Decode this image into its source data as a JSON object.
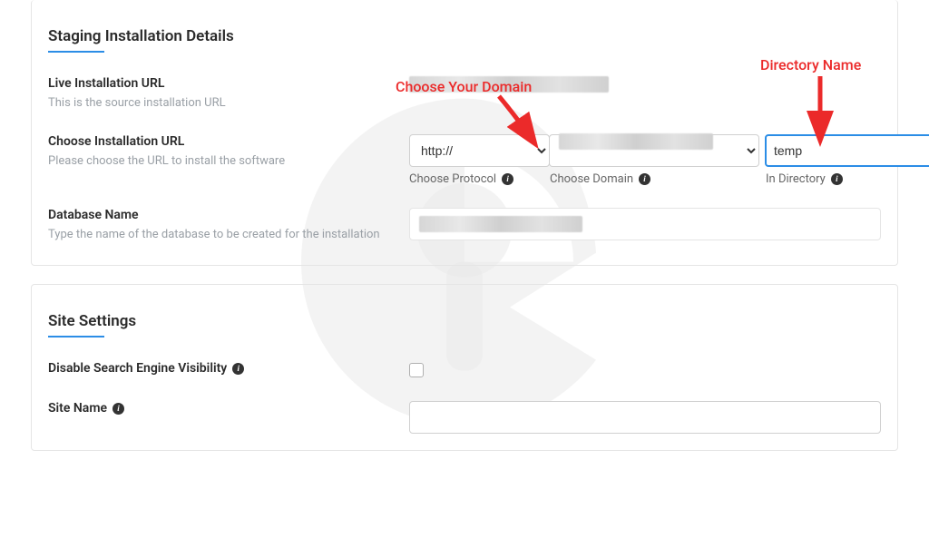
{
  "staging": {
    "title": "Staging Installation Details",
    "live_url": {
      "label": "Live Installation URL",
      "desc": "This is the source installation URL"
    },
    "install_url": {
      "label": "Choose Installation URL",
      "desc": "Please choose the URL to install the software",
      "protocol_value": "http://",
      "protocol_sub": "Choose Protocol",
      "domain_sub": "Choose Domain",
      "directory_value": "temp",
      "directory_sub": "In Directory"
    },
    "db": {
      "label": "Database Name",
      "desc": "Type the name of the database to be created for the installation"
    }
  },
  "site": {
    "title": "Site Settings",
    "disable_sev": "Disable Search Engine Visibility",
    "site_name": "Site Name"
  },
  "annotations": {
    "choose_domain": "Choose Your Domain",
    "directory_name": "Directory Name"
  }
}
